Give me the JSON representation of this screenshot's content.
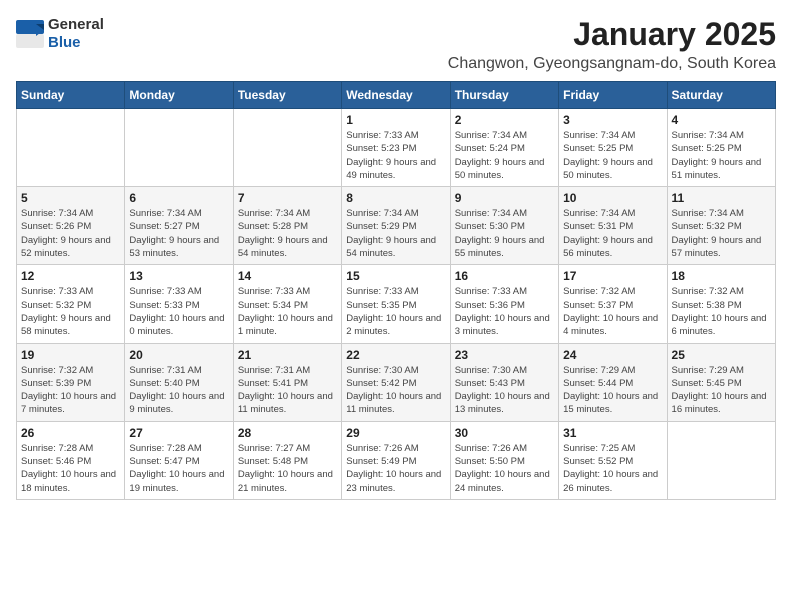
{
  "logo": {
    "general": "General",
    "blue": "Blue"
  },
  "header": {
    "title": "January 2025",
    "subtitle": "Changwon, Gyeongsangnam-do, South Korea"
  },
  "weekdays": [
    "Sunday",
    "Monday",
    "Tuesday",
    "Wednesday",
    "Thursday",
    "Friday",
    "Saturday"
  ],
  "weeks": [
    [
      {
        "day": "",
        "sunrise": "",
        "sunset": "",
        "daylight": ""
      },
      {
        "day": "",
        "sunrise": "",
        "sunset": "",
        "daylight": ""
      },
      {
        "day": "",
        "sunrise": "",
        "sunset": "",
        "daylight": ""
      },
      {
        "day": "1",
        "sunrise": "Sunrise: 7:33 AM",
        "sunset": "Sunset: 5:23 PM",
        "daylight": "Daylight: 9 hours and 49 minutes."
      },
      {
        "day": "2",
        "sunrise": "Sunrise: 7:34 AM",
        "sunset": "Sunset: 5:24 PM",
        "daylight": "Daylight: 9 hours and 50 minutes."
      },
      {
        "day": "3",
        "sunrise": "Sunrise: 7:34 AM",
        "sunset": "Sunset: 5:25 PM",
        "daylight": "Daylight: 9 hours and 50 minutes."
      },
      {
        "day": "4",
        "sunrise": "Sunrise: 7:34 AM",
        "sunset": "Sunset: 5:25 PM",
        "daylight": "Daylight: 9 hours and 51 minutes."
      }
    ],
    [
      {
        "day": "5",
        "sunrise": "Sunrise: 7:34 AM",
        "sunset": "Sunset: 5:26 PM",
        "daylight": "Daylight: 9 hours and 52 minutes."
      },
      {
        "day": "6",
        "sunrise": "Sunrise: 7:34 AM",
        "sunset": "Sunset: 5:27 PM",
        "daylight": "Daylight: 9 hours and 53 minutes."
      },
      {
        "day": "7",
        "sunrise": "Sunrise: 7:34 AM",
        "sunset": "Sunset: 5:28 PM",
        "daylight": "Daylight: 9 hours and 54 minutes."
      },
      {
        "day": "8",
        "sunrise": "Sunrise: 7:34 AM",
        "sunset": "Sunset: 5:29 PM",
        "daylight": "Daylight: 9 hours and 54 minutes."
      },
      {
        "day": "9",
        "sunrise": "Sunrise: 7:34 AM",
        "sunset": "Sunset: 5:30 PM",
        "daylight": "Daylight: 9 hours and 55 minutes."
      },
      {
        "day": "10",
        "sunrise": "Sunrise: 7:34 AM",
        "sunset": "Sunset: 5:31 PM",
        "daylight": "Daylight: 9 hours and 56 minutes."
      },
      {
        "day": "11",
        "sunrise": "Sunrise: 7:34 AM",
        "sunset": "Sunset: 5:32 PM",
        "daylight": "Daylight: 9 hours and 57 minutes."
      }
    ],
    [
      {
        "day": "12",
        "sunrise": "Sunrise: 7:33 AM",
        "sunset": "Sunset: 5:32 PM",
        "daylight": "Daylight: 9 hours and 58 minutes."
      },
      {
        "day": "13",
        "sunrise": "Sunrise: 7:33 AM",
        "sunset": "Sunset: 5:33 PM",
        "daylight": "Daylight: 10 hours and 0 minutes."
      },
      {
        "day": "14",
        "sunrise": "Sunrise: 7:33 AM",
        "sunset": "Sunset: 5:34 PM",
        "daylight": "Daylight: 10 hours and 1 minute."
      },
      {
        "day": "15",
        "sunrise": "Sunrise: 7:33 AM",
        "sunset": "Sunset: 5:35 PM",
        "daylight": "Daylight: 10 hours and 2 minutes."
      },
      {
        "day": "16",
        "sunrise": "Sunrise: 7:33 AM",
        "sunset": "Sunset: 5:36 PM",
        "daylight": "Daylight: 10 hours and 3 minutes."
      },
      {
        "day": "17",
        "sunrise": "Sunrise: 7:32 AM",
        "sunset": "Sunset: 5:37 PM",
        "daylight": "Daylight: 10 hours and 4 minutes."
      },
      {
        "day": "18",
        "sunrise": "Sunrise: 7:32 AM",
        "sunset": "Sunset: 5:38 PM",
        "daylight": "Daylight: 10 hours and 6 minutes."
      }
    ],
    [
      {
        "day": "19",
        "sunrise": "Sunrise: 7:32 AM",
        "sunset": "Sunset: 5:39 PM",
        "daylight": "Daylight: 10 hours and 7 minutes."
      },
      {
        "day": "20",
        "sunrise": "Sunrise: 7:31 AM",
        "sunset": "Sunset: 5:40 PM",
        "daylight": "Daylight: 10 hours and 9 minutes."
      },
      {
        "day": "21",
        "sunrise": "Sunrise: 7:31 AM",
        "sunset": "Sunset: 5:41 PM",
        "daylight": "Daylight: 10 hours and 11 minutes."
      },
      {
        "day": "22",
        "sunrise": "Sunrise: 7:30 AM",
        "sunset": "Sunset: 5:42 PM",
        "daylight": "Daylight: 10 hours and 11 minutes."
      },
      {
        "day": "23",
        "sunrise": "Sunrise: 7:30 AM",
        "sunset": "Sunset: 5:43 PM",
        "daylight": "Daylight: 10 hours and 13 minutes."
      },
      {
        "day": "24",
        "sunrise": "Sunrise: 7:29 AM",
        "sunset": "Sunset: 5:44 PM",
        "daylight": "Daylight: 10 hours and 15 minutes."
      },
      {
        "day": "25",
        "sunrise": "Sunrise: 7:29 AM",
        "sunset": "Sunset: 5:45 PM",
        "daylight": "Daylight: 10 hours and 16 minutes."
      }
    ],
    [
      {
        "day": "26",
        "sunrise": "Sunrise: 7:28 AM",
        "sunset": "Sunset: 5:46 PM",
        "daylight": "Daylight: 10 hours and 18 minutes."
      },
      {
        "day": "27",
        "sunrise": "Sunrise: 7:28 AM",
        "sunset": "Sunset: 5:47 PM",
        "daylight": "Daylight: 10 hours and 19 minutes."
      },
      {
        "day": "28",
        "sunrise": "Sunrise: 7:27 AM",
        "sunset": "Sunset: 5:48 PM",
        "daylight": "Daylight: 10 hours and 21 minutes."
      },
      {
        "day": "29",
        "sunrise": "Sunrise: 7:26 AM",
        "sunset": "Sunset: 5:49 PM",
        "daylight": "Daylight: 10 hours and 23 minutes."
      },
      {
        "day": "30",
        "sunrise": "Sunrise: 7:26 AM",
        "sunset": "Sunset: 5:50 PM",
        "daylight": "Daylight: 10 hours and 24 minutes."
      },
      {
        "day": "31",
        "sunrise": "Sunrise: 7:25 AM",
        "sunset": "Sunset: 5:52 PM",
        "daylight": "Daylight: 10 hours and 26 minutes."
      },
      {
        "day": "",
        "sunrise": "",
        "sunset": "",
        "daylight": ""
      }
    ]
  ]
}
